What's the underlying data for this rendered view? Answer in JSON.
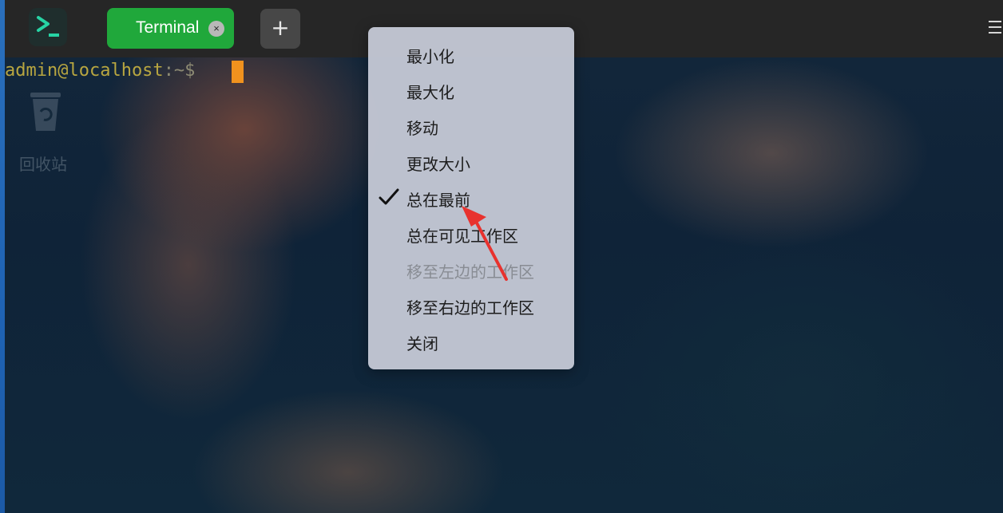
{
  "colors": {
    "tab_active_bg": "#20a83b",
    "titlebar_bg": "#262626",
    "prompt_color": "#b8a640",
    "cursor_color": "#f0921e",
    "menu_bg": "#c4c8d4",
    "annotation_arrow": "#e8322e"
  },
  "titlebar": {
    "app_icon": "terminal-app-icon",
    "tab_label": "Terminal",
    "tab_close_glyph": "×",
    "new_tab_glyph": "+",
    "menu_icon": "hamburger-menu-icon"
  },
  "terminal": {
    "user_host": "admin@localhost",
    "path_symbol": ":~$"
  },
  "desktop": {
    "trash_label": "回收站",
    "trash_icon": "recycle-bin-icon"
  },
  "context_menu": {
    "items": [
      {
        "label": "最小化",
        "checked": false,
        "disabled": false
      },
      {
        "label": "最大化",
        "checked": false,
        "disabled": false
      },
      {
        "label": "移动",
        "checked": false,
        "disabled": false
      },
      {
        "label": "更改大小",
        "checked": false,
        "disabled": false
      },
      {
        "label": "总在最前",
        "checked": true,
        "disabled": false
      },
      {
        "label": "总在可见工作区",
        "checked": false,
        "disabled": false
      },
      {
        "label": "移至左边的工作区",
        "checked": false,
        "disabled": true
      },
      {
        "label": "移至右边的工作区",
        "checked": false,
        "disabled": false
      },
      {
        "label": "关闭",
        "checked": false,
        "disabled": false
      }
    ],
    "check_icon": "checkmark-icon"
  },
  "annotation": {
    "type": "red-arrow",
    "points_to": "总在最前"
  }
}
